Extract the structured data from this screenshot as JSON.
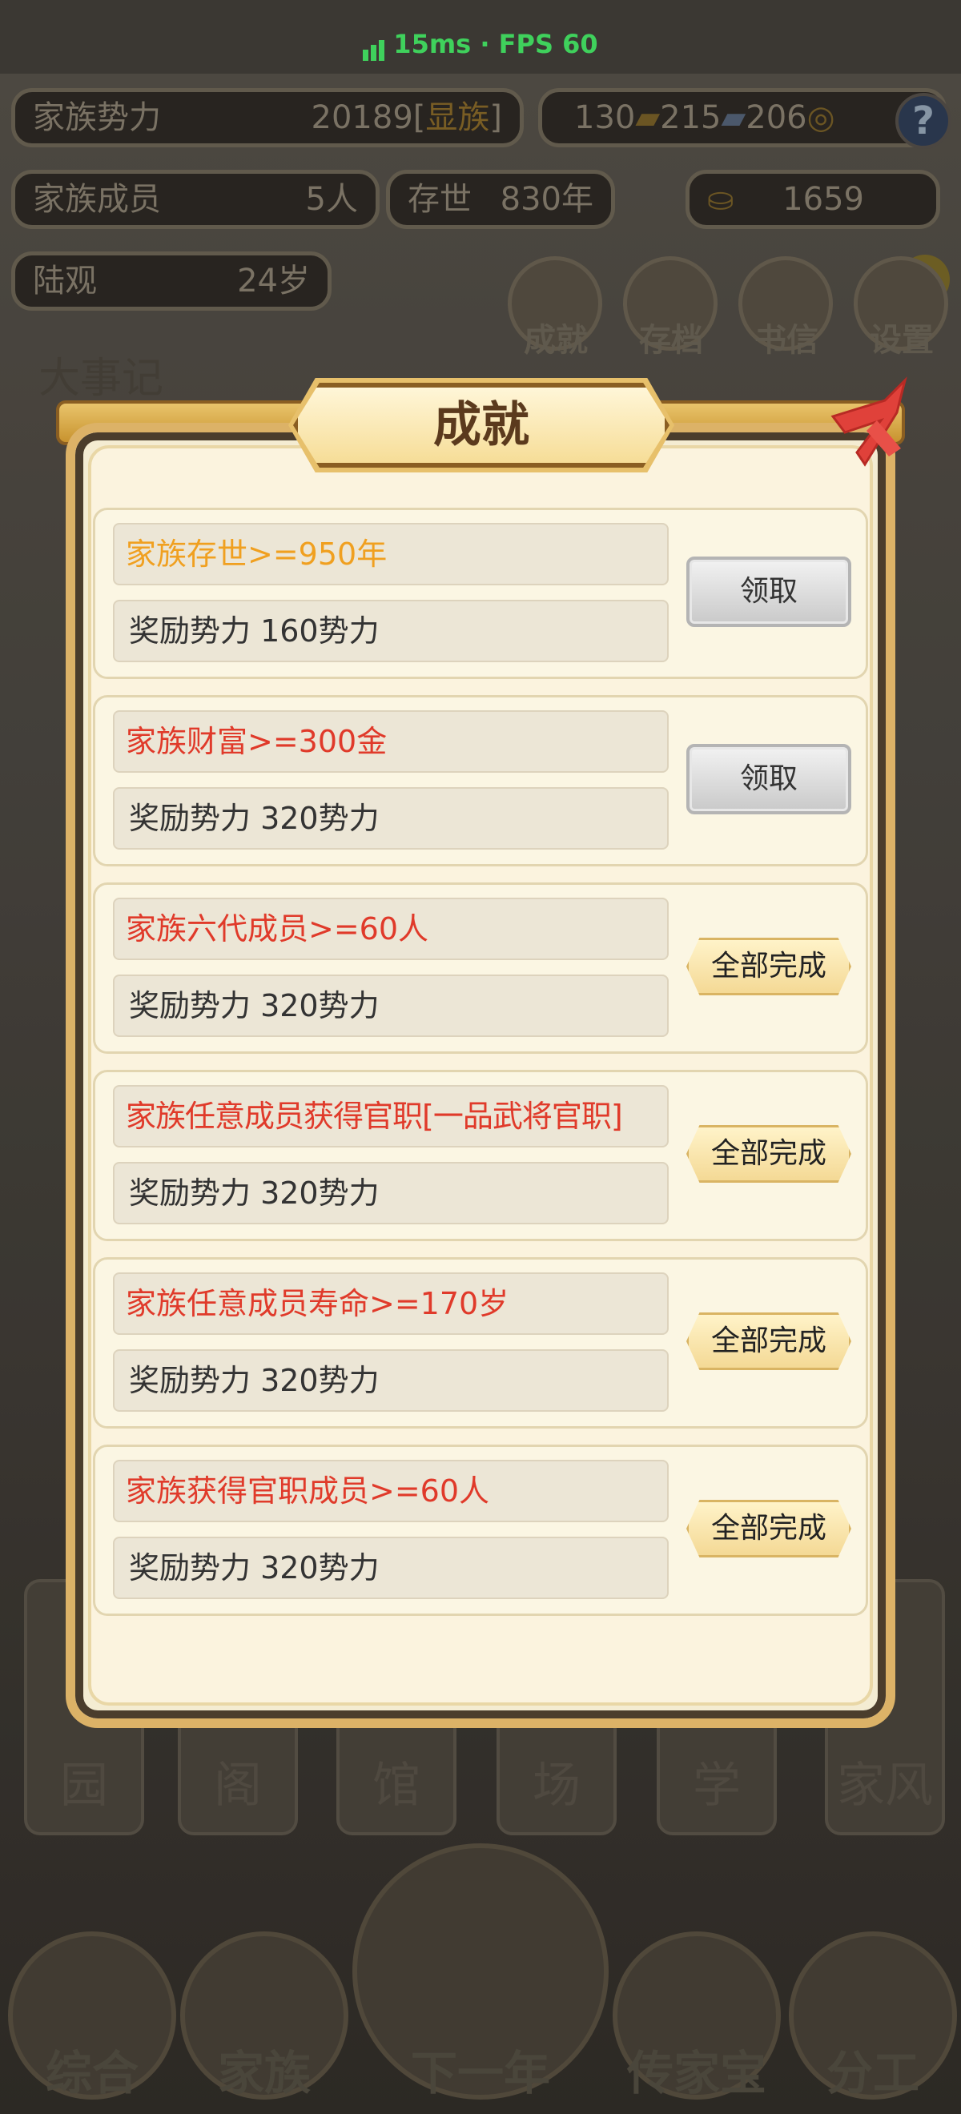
{
  "status_bar": {
    "text": "15ms · FPS 60"
  },
  "hud": {
    "clan_power_label": "家族势力",
    "clan_power_value": "20189",
    "clan_rank_open": "[",
    "clan_rank": "显族",
    "clan_rank_close": "]",
    "res1": "130",
    "res2": "215",
    "res3": "206",
    "help": "?",
    "members_label": "家族成员",
    "members_value": "5人",
    "exist_label": "存世",
    "exist_value": "830年",
    "gold_value": "1659",
    "plus": "+",
    "person_name": "陆观",
    "person_age": "24岁",
    "menu": [
      "成就",
      "存档",
      "书信",
      "设置"
    ],
    "events_title": "大事记"
  },
  "bg_cards": [
    "园",
    "阁",
    "馆",
    "场",
    "学",
    "家风"
  ],
  "bottom_nav": [
    "综合",
    "家族",
    "下一年",
    "传家宝",
    "分工"
  ],
  "dialog": {
    "title": "成就",
    "items": [
      {
        "title": "家族存世>=950年",
        "reward": "奖励势力 160势力",
        "button": "领取",
        "state": "claim",
        "color": "orange"
      },
      {
        "title": "家族财富>=300金",
        "reward": "奖励势力 320势力",
        "button": "领取",
        "state": "claim",
        "color": "red"
      },
      {
        "title": "家族六代成员>=60人",
        "reward": "奖励势力 320势力",
        "button": "全部完成",
        "state": "done",
        "color": "red"
      },
      {
        "title": "家族任意成员获得官职[一品武将官职]",
        "reward": "奖励势力 320势力",
        "button": "全部完成",
        "state": "done",
        "color": "red"
      },
      {
        "title": "家族任意成员寿命>=170岁",
        "reward": "奖励势力 320势力",
        "button": "全部完成",
        "state": "done",
        "color": "red"
      },
      {
        "title": "家族获得官职成员>=60人",
        "reward": "奖励势力 320势力",
        "button": "全部完成",
        "state": "done",
        "color": "red"
      }
    ]
  },
  "colors": {
    "title_orange": "#f0a020",
    "title_red": "#e03a2a",
    "frame_gold": "#dcb267"
  }
}
